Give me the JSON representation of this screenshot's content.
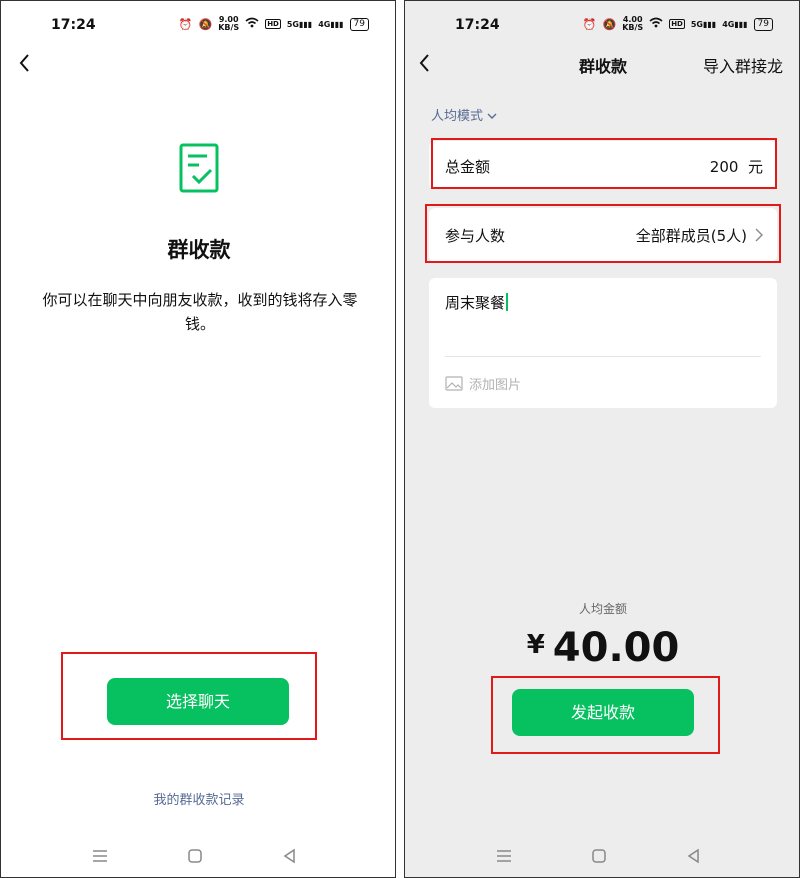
{
  "left": {
    "status": {
      "time": "17:24",
      "speed_value": "9.00",
      "speed_unit": "KB/S",
      "battery": "79"
    },
    "title": "群收款",
    "description": "你可以在聊天中向朋友收款，收到的钱将存入零钱。",
    "select_chat_button": "选择聊天",
    "records_link": "我的群收款记录"
  },
  "right": {
    "status": {
      "time": "17:24",
      "speed_value": "4.00",
      "speed_unit": "KB/S",
      "battery": "79"
    },
    "nav_title": "群收款",
    "nav_right": "导入群接龙",
    "mode_label": "人均模式",
    "total_label": "总金额",
    "total_value": "200",
    "total_unit": "元",
    "participants_label": "参与人数",
    "participants_value": "全部群成员(5人)",
    "note_text": "周末聚餐",
    "add_image_label": "添加图片",
    "avg_label": "人均金额",
    "avg_currency": "¥",
    "avg_value": "40.00",
    "submit_button": "发起收款"
  },
  "colors": {
    "accent": "#07c160",
    "link": "#576b95",
    "highlight": "#e11919"
  }
}
